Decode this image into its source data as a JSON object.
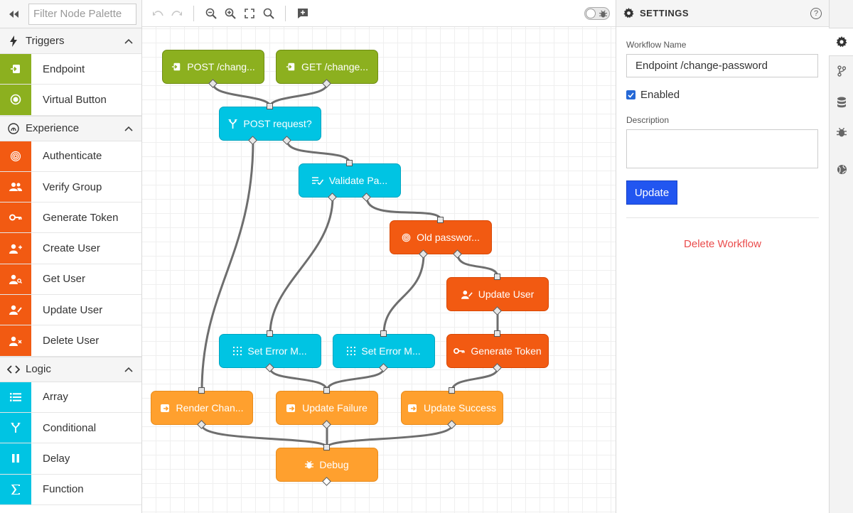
{
  "palette": {
    "filter_placeholder": "Filter Node Palette",
    "categories": [
      {
        "label": "Triggers",
        "items": [
          {
            "label": "Endpoint",
            "color": "#8cb01f"
          },
          {
            "label": "Virtual Button",
            "color": "#8cb01f"
          }
        ]
      },
      {
        "label": "Experience",
        "items": [
          {
            "label": "Authenticate",
            "color": "#f25a12"
          },
          {
            "label": "Verify Group",
            "color": "#f25a12"
          },
          {
            "label": "Generate Token",
            "color": "#f25a12"
          },
          {
            "label": "Create User",
            "color": "#f25a12"
          },
          {
            "label": "Get User",
            "color": "#f25a12"
          },
          {
            "label": "Update User",
            "color": "#f25a12"
          },
          {
            "label": "Delete User",
            "color": "#f25a12"
          }
        ]
      },
      {
        "label": "Logic",
        "items": [
          {
            "label": "Array",
            "color": "#00c4e3"
          },
          {
            "label": "Conditional",
            "color": "#00c4e3"
          },
          {
            "label": "Delay",
            "color": "#00c4e3"
          },
          {
            "label": "Function",
            "color": "#00c4e3"
          }
        ]
      }
    ]
  },
  "workflow": {
    "nodes": [
      {
        "label": "POST /chang...",
        "icon": "endpoint-icon"
      },
      {
        "label": "GET /change...",
        "icon": "endpoint-icon"
      },
      {
        "label": "POST request?",
        "icon": "conditional-icon"
      },
      {
        "label": "Validate Pa...",
        "icon": "validate-icon"
      },
      {
        "label": "Old passwor...",
        "icon": "fingerprint-icon"
      },
      {
        "label": "Update User",
        "icon": "update-user-icon"
      },
      {
        "label": "Set Error M...",
        "icon": "mutate-icon"
      },
      {
        "label": "Set Error M...",
        "icon": "mutate-icon"
      },
      {
        "label": "Generate Token",
        "icon": "key-icon"
      },
      {
        "label": "Render Chan...",
        "icon": "reply-icon"
      },
      {
        "label": "Update Failure",
        "icon": "reply-icon"
      },
      {
        "label": "Update Success",
        "icon": "reply-icon"
      },
      {
        "label": "Debug",
        "icon": "debug-icon"
      }
    ]
  },
  "settings": {
    "title": "SETTINGS",
    "workflow_name_label": "Workflow Name",
    "workflow_name_value": "Endpoint /change-password",
    "enabled_label": "Enabled",
    "enabled": true,
    "description_label": "Description",
    "description_value": "",
    "update_label": "Update",
    "delete_label": "Delete Workflow"
  },
  "colors": {
    "trigger": "#8cb01f",
    "logic": "#00c4e3",
    "experience": "#f25a12",
    "output": "#ffa02e",
    "primary_button": "#2256f0",
    "danger": "#ea4c4c"
  }
}
